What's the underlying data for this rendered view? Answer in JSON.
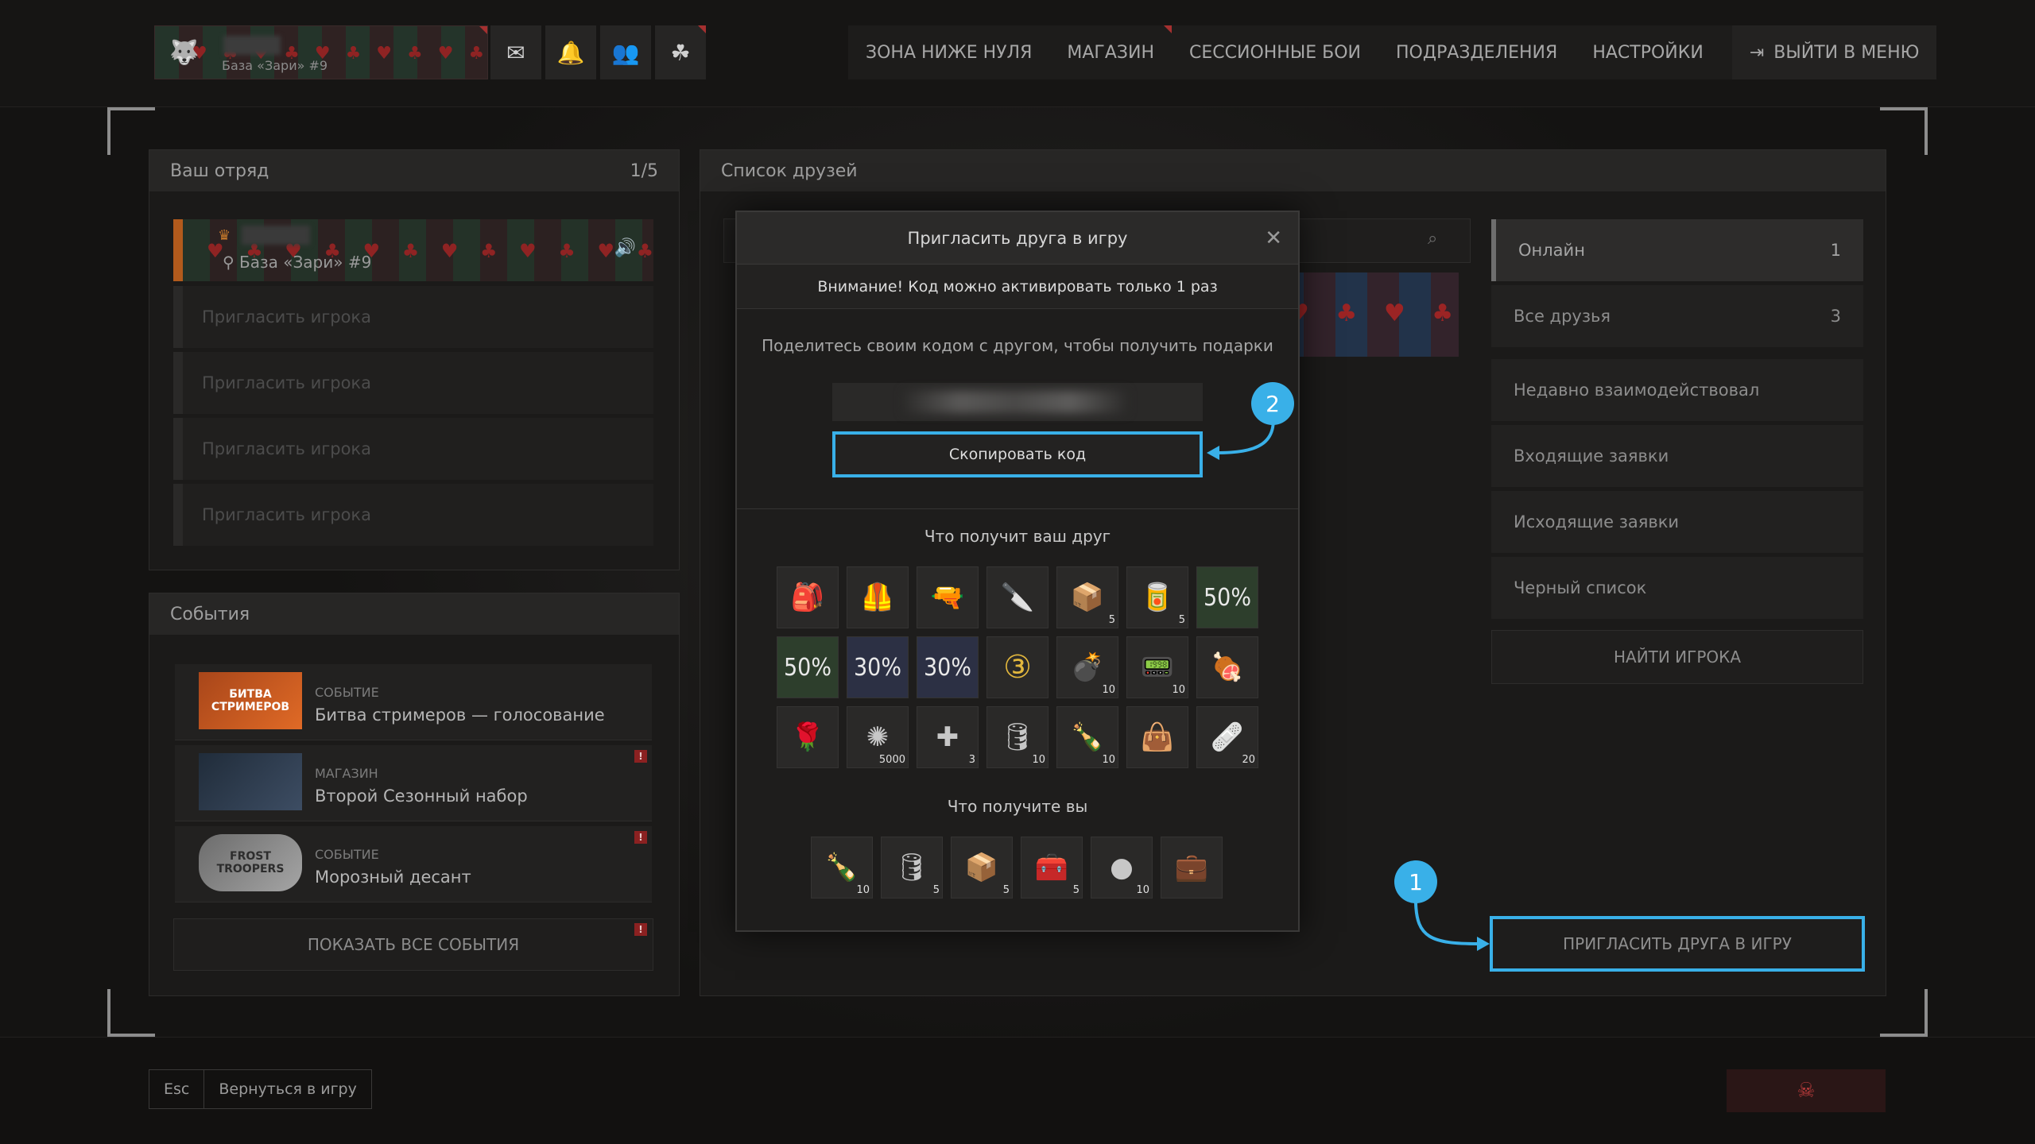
{
  "topbar": {
    "profile_base": "База «Зари» #9",
    "icons": [
      "mail-icon",
      "bell-icon",
      "friends-icon",
      "units-icon"
    ],
    "nav": [
      "ЗОНА НИЖЕ НУЛЯ",
      "МАГАЗИН",
      "СЕССИОННЫЕ БОИ",
      "ПОДРАЗДЕЛЕНИЯ",
      "НАСТРОЙКИ"
    ],
    "exit_label": "ВЫЙТИ В МЕНЮ"
  },
  "squad": {
    "title": "Ваш отряд",
    "count": "1/5",
    "leader_base": "База «Зари» #9",
    "invite_slots": [
      "Пригласить игрока",
      "Пригласить игрока",
      "Пригласить игрока",
      "Пригласить игрока"
    ]
  },
  "events": {
    "title": "События",
    "items": [
      {
        "category": "СОБЫТИЕ",
        "title": "Битва стримеров — голосование",
        "thumb_text": "БИТВА СТРИМЕРОВ"
      },
      {
        "category": "МАГАЗИН",
        "title": "Второй Сезонный набор",
        "thumb_text": ""
      },
      {
        "category": "СОБЫТИЕ",
        "title": "Морозный десант",
        "thumb_text": "FROST TROOPERS"
      }
    ],
    "show_all": "ПОКАЗАТЬ ВСЕ СОБЫТИЯ"
  },
  "friends": {
    "title": "Список друзей",
    "filters": [
      {
        "label": "Онлайн",
        "count": "1"
      },
      {
        "label": "Все друзья",
        "count": "3"
      },
      {
        "label": "Недавно взаимодействовал",
        "count": ""
      },
      {
        "label": "Входящие заявки",
        "count": ""
      },
      {
        "label": "Исходящие заявки",
        "count": ""
      },
      {
        "label": "Черный список",
        "count": ""
      }
    ],
    "find_player": "НАЙТИ ИГРОКА",
    "invite_friend": "ПРИГЛАСИТЬ ДРУГА В ИГРУ"
  },
  "modal": {
    "title": "Пригласить друга в игру",
    "warning": "Внимание! Код можно активировать только 1 раз",
    "share_text": "Поделитесь своим кодом с другом, чтобы получить подарки",
    "copy_button": "Скопировать код",
    "friend_gets_title": "Что получит ваш друг",
    "friend_gets": [
      {
        "icon": "backpack-icon",
        "count": "",
        "glyph": "🎒"
      },
      {
        "icon": "vest-icon",
        "count": "",
        "glyph": "🦺"
      },
      {
        "icon": "pistol-icon",
        "count": "",
        "glyph": "🔫"
      },
      {
        "icon": "knife-icon",
        "count": "",
        "glyph": "🔪"
      },
      {
        "icon": "crate-icon",
        "count": "5",
        "glyph": "📦"
      },
      {
        "icon": "ration-icon",
        "count": "5",
        "glyph": "🥫"
      },
      {
        "icon": "discount-50-icon",
        "count": "",
        "glyph": "50%",
        "style": "pct"
      },
      {
        "icon": "discount-50-icon",
        "count": "",
        "glyph": "50%",
        "style": "pct"
      },
      {
        "icon": "discount-30-icon",
        "count": "",
        "glyph": "30%",
        "style": "pct blue"
      },
      {
        "icon": "discount-30-icon",
        "count": "",
        "glyph": "30%",
        "style": "pct blue"
      },
      {
        "icon": "gold-3-icon",
        "count": "",
        "glyph": "③",
        "style": "gold"
      },
      {
        "icon": "grenade-icon",
        "count": "10",
        "glyph": "💣"
      },
      {
        "icon": "device-icon",
        "count": "10",
        "glyph": "📟"
      },
      {
        "icon": "meat-icon",
        "count": "",
        "glyph": "🍖"
      },
      {
        "icon": "rose-icon",
        "count": "",
        "glyph": "🌹"
      },
      {
        "icon": "energy-orb-icon",
        "count": "5000",
        "glyph": "✺"
      },
      {
        "icon": "medkit-icon",
        "count": "3",
        "glyph": "✚"
      },
      {
        "icon": "canister-icon",
        "count": "10",
        "glyph": "🛢"
      },
      {
        "icon": "bottle-icon",
        "count": "10",
        "glyph": "🍾"
      },
      {
        "icon": "bag-icon",
        "count": "",
        "glyph": "👜"
      },
      {
        "icon": "bandage-icon",
        "count": "20",
        "glyph": "🩹"
      }
    ],
    "you_get_title": "Что получите вы",
    "you_get": [
      {
        "icon": "bottle-icon",
        "count": "10",
        "glyph": "🍾"
      },
      {
        "icon": "canister-icon",
        "count": "5",
        "glyph": "🛢"
      },
      {
        "icon": "crate-icon",
        "count": "5",
        "glyph": "📦"
      },
      {
        "icon": "ammo-box-icon",
        "count": "5",
        "glyph": "🧰"
      },
      {
        "icon": "glow-orb-icon",
        "count": "10",
        "glyph": "●"
      },
      {
        "icon": "med-bag-icon",
        "count": "",
        "glyph": "💼"
      }
    ]
  },
  "markers": [
    "1",
    "2"
  ],
  "bottom": {
    "esc_key": "Esc",
    "back_label": "Вернуться в игру"
  },
  "colors": {
    "highlight": "#39b0e8",
    "accent_orange": "#b25a1c",
    "alert": "#8b2121"
  }
}
